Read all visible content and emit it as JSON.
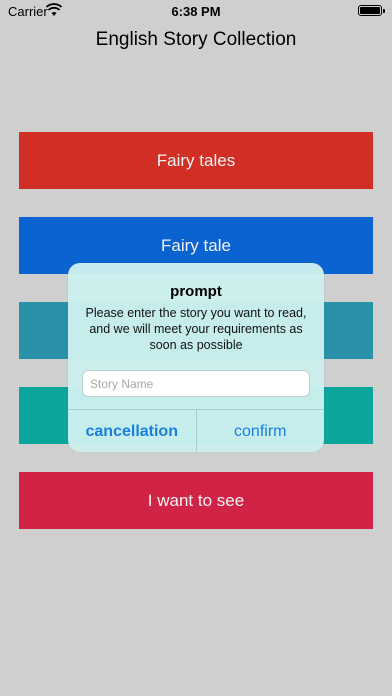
{
  "status_bar": {
    "carrier": "Carrier",
    "time": "6:38 PM"
  },
  "page_title": "English Story Collection",
  "buttons": [
    {
      "label": "Fairy tales",
      "color": "#d12f26"
    },
    {
      "label": "Fairy tale",
      "color": "#0a63d0"
    },
    {
      "label": "",
      "color": "#2a92a8"
    },
    {
      "label": "",
      "color": "#0aa59c"
    },
    {
      "label": "I want to see",
      "color": "#d02345"
    }
  ],
  "alert": {
    "title": "prompt",
    "message": "Please enter the story you want to read, and we will meet your requirements as soon as possible",
    "input_placeholder": "Story Name",
    "input_value": "",
    "cancel_label": "cancellation",
    "confirm_label": "confirm"
  }
}
